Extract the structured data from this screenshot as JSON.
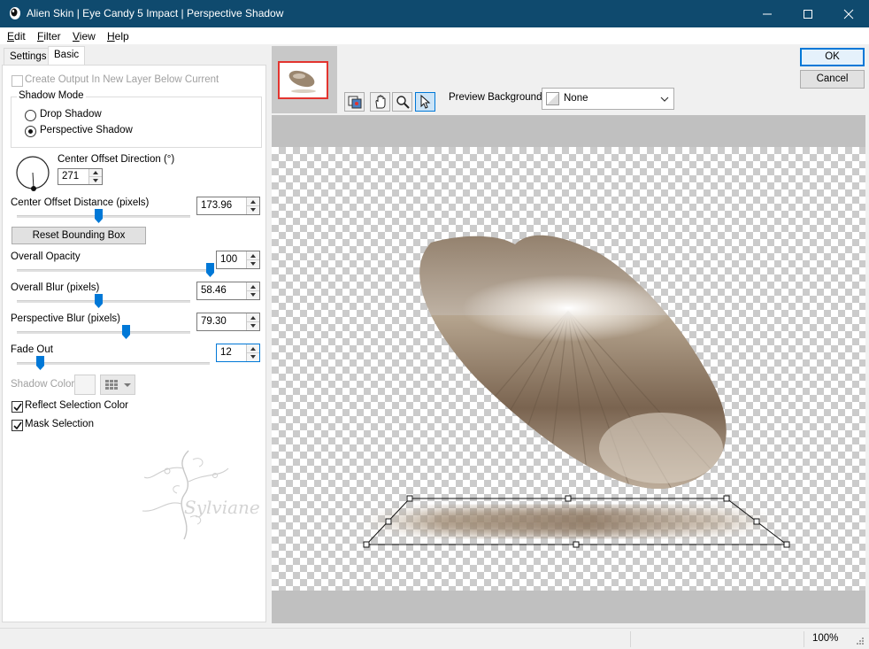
{
  "window": {
    "title": "Alien Skin | Eye Candy 5 Impact | Perspective Shadow",
    "title_bar_color": "#0f4a6e"
  },
  "menu": [
    {
      "accel": "E",
      "rest": "dit"
    },
    {
      "accel": "F",
      "rest": "ilter"
    },
    {
      "accel": "V",
      "rest": "iew"
    },
    {
      "accel": "H",
      "rest": "elp"
    }
  ],
  "tabs": {
    "settings": "Settings",
    "basic": "Basic"
  },
  "basic": {
    "create_output_label": "Create Output In New Layer Below Current",
    "create_output_checked": false,
    "shadow_mode": {
      "title": "Shadow Mode",
      "drop": "Drop Shadow",
      "perspective": "Perspective Shadow",
      "selected": "perspective"
    },
    "center_offset_direction": {
      "label": "Center Offset Direction (°)",
      "value": "271"
    },
    "center_offset_distance": {
      "label": "Center Offset Distance (pixels)",
      "value": "173.96",
      "fraction": 0.47
    },
    "reset_bbox": "Reset Bounding Box",
    "overall_opacity": {
      "label": "Overall Opacity",
      "value": "100",
      "fraction": 1.0
    },
    "overall_blur": {
      "label": "Overall Blur (pixels)",
      "value": "58.46",
      "fraction": 0.47
    },
    "perspective_blur": {
      "label": "Perspective Blur (pixels)",
      "value": "79.30",
      "fraction": 0.63
    },
    "fade_out": {
      "label": "Fade Out",
      "value": "12",
      "fraction": 0.12
    },
    "shadow_color_label": "Shadow Color",
    "reflect_selection_color": {
      "label": "Reflect Selection Color",
      "checked": true
    },
    "mask_selection": {
      "label": "Mask Selection",
      "checked": true
    }
  },
  "watermark_text": "Sylviane",
  "buttons": {
    "ok": "OK",
    "cancel": "Cancel"
  },
  "preview": {
    "background_label": "Preview Background:",
    "background_value": "None",
    "tools": [
      "compare-icon",
      "hand-pan-icon",
      "zoom-icon",
      "pointer-icon"
    ]
  },
  "status": {
    "zoom": "100%"
  },
  "colors": {
    "accent": "#0078d7",
    "thumbnail_border": "#e3342f"
  }
}
